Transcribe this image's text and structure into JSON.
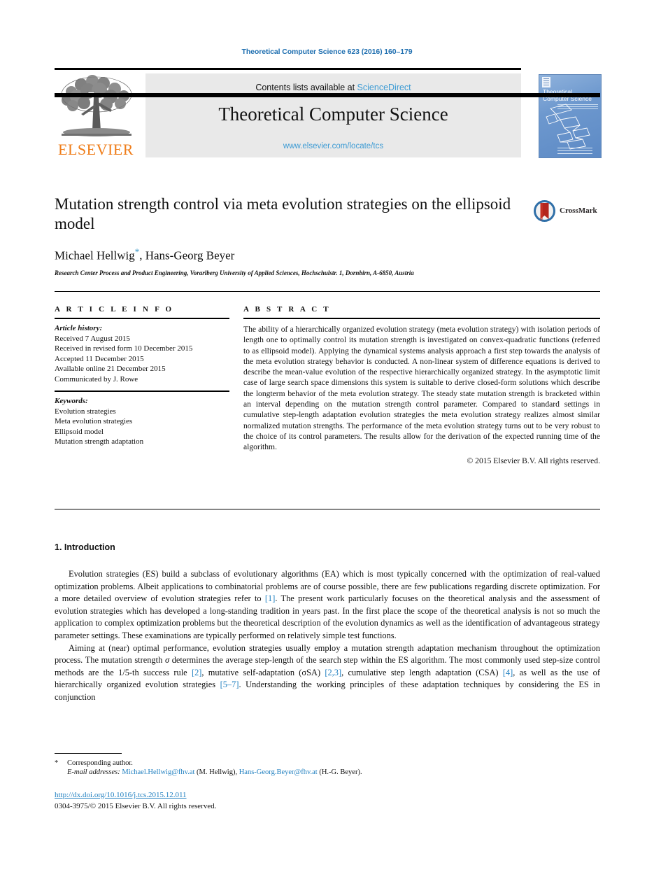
{
  "running_head": "Theoretical Computer Science 623 (2016) 160–179",
  "masthead": {
    "publisher_wordmark": "ELSEVIER",
    "publisher_logo_icon": "elsevier-tree-icon",
    "contents_prefix": "Contents lists available at ",
    "contents_link": "ScienceDirect",
    "journal_name": "Theoretical Computer Science",
    "journal_url": "www.elsevier.com/locate/tcs",
    "cover": {
      "title_line1": "Theoretical",
      "title_line2": "Computer Science"
    }
  },
  "article": {
    "title": "Mutation strength control via meta evolution strategies on the ellipsoid model",
    "authors": "Michael Hellwig",
    "author_star": "*",
    "authors_rest": ", Hans-Georg Beyer",
    "affiliation": "Research Center Process and Product Engineering, Vorarlberg University of Applied Sciences, Hochschulstr. 1, Dornbirn, A-6850, Austria",
    "crossmark_label": "CrossMark"
  },
  "info": {
    "heading": "A R T I C L E   I N F O",
    "history_label": "Article history:",
    "history": [
      "Received 7 August 2015",
      "Received in revised form 10 December 2015",
      "Accepted 11 December 2015",
      "Available online 21 December 2015",
      "Communicated by J. Rowe"
    ],
    "keywords_label": "Keywords:",
    "keywords": [
      "Evolution strategies",
      "Meta evolution strategies",
      "Ellipsoid model",
      "Mutation strength adaptation"
    ]
  },
  "abstract": {
    "heading": "A B S T R A C T",
    "text": "The ability of a hierarchically organized evolution strategy (meta evolution strategy)  with isolation periods of length one to optimally control its mutation strength is investigated on convex-quadratic functions (referred to as ellipsoid model). Applying the dynamical systems analysis approach a first step towards the analysis of the meta evolution strategy behavior is conducted. A non-linear system of difference equations is derived to describe the mean-value evolution of  the respective hierarchically organized strategy. In the asymptotic limit case of large search space dimensions this system is suitable to derive closed-form solutions which describe the longterm behavior of the meta evolution strategy. The steady state mutation strength is bracketed within an interval depending on the mutation strength control parameter. Compared to standard settings in cumulative step-length adaptation evolution strategies the meta evolution strategy realizes almost similar normalized mutation strengths. The performance of the meta evolution strategy turns out to be very robust to the choice of its control parameters. The results allow for the derivation of the expected running time of the algorithm.",
    "copyright": "© 2015 Elsevier B.V. All rights reserved."
  },
  "body": {
    "section_number_title": "1. Introduction",
    "paragraph1_a": "Evolution strategies (ES) build a subclass of evolutionary algorithms (EA) which is most typically concerned with the optimization of real-valued optimization problems. Albeit applications to combinatorial problems are of course possible, there are few publications regarding discrete optimization. For a more detailed overview of evolution strategies refer to ",
    "paragraph1_ref1": "[1]",
    "paragraph1_b": ". The present work particularly focuses on the theoretical analysis and the assessment of evolution strategies which has developed a long-standing tradition in years past. In the first place the scope of the theoretical analysis is not so much the application to complex optimization problems but the theoretical description of the evolution dynamics as well as the identification of advantageous strategy parameter settings. These examinations are typically performed on relatively simple test functions.",
    "paragraph2_a": "Aiming at (near) optimal performance, evolution strategies usually employ a mutation strength adaptation mechanism throughout the optimization process. The mutation strength ",
    "paragraph2_sigma": "σ",
    "paragraph2_b": " determines the average step-length of the search step within the ES algorithm. The most commonly used step-size control methods are the 1/5-th success rule ",
    "paragraph2_ref2": "[2]",
    "paragraph2_c": ", mutative self-adaptation (σSA) ",
    "paragraph2_ref23": "[2,3]",
    "paragraph2_d": ", cumulative step length adaptation (CSA) ",
    "paragraph2_ref4": "[4]",
    "paragraph2_e": ", as well as the use of hierarchically organized evolution strategies ",
    "paragraph2_ref57": "[5–7]",
    "paragraph2_f": ". Understanding the working principles of these adaptation techniques by considering the ES in conjunction"
  },
  "footer": {
    "corresponding_star": "*",
    "corresponding_author": "Corresponding author.",
    "email_label": "E-mail addresses:",
    "email1": "Michael.Hellwig@fhv.at",
    "email1_owner": " (M. Hellwig), ",
    "email2": "Hans-Georg.Beyer@fhv.at",
    "email2_owner": " (H.-G. Beyer).",
    "doi": "http://dx.doi.org/10.1016/j.tcs.2015.12.011",
    "issn_line": "0304-3975/© 2015 Elsevier B.V. All rights reserved."
  },
  "colors": {
    "link_blue": "#1f7fc0",
    "sciencedirect_blue": "#3d9bd4",
    "elsevier_orange": "#ef7d1a"
  }
}
